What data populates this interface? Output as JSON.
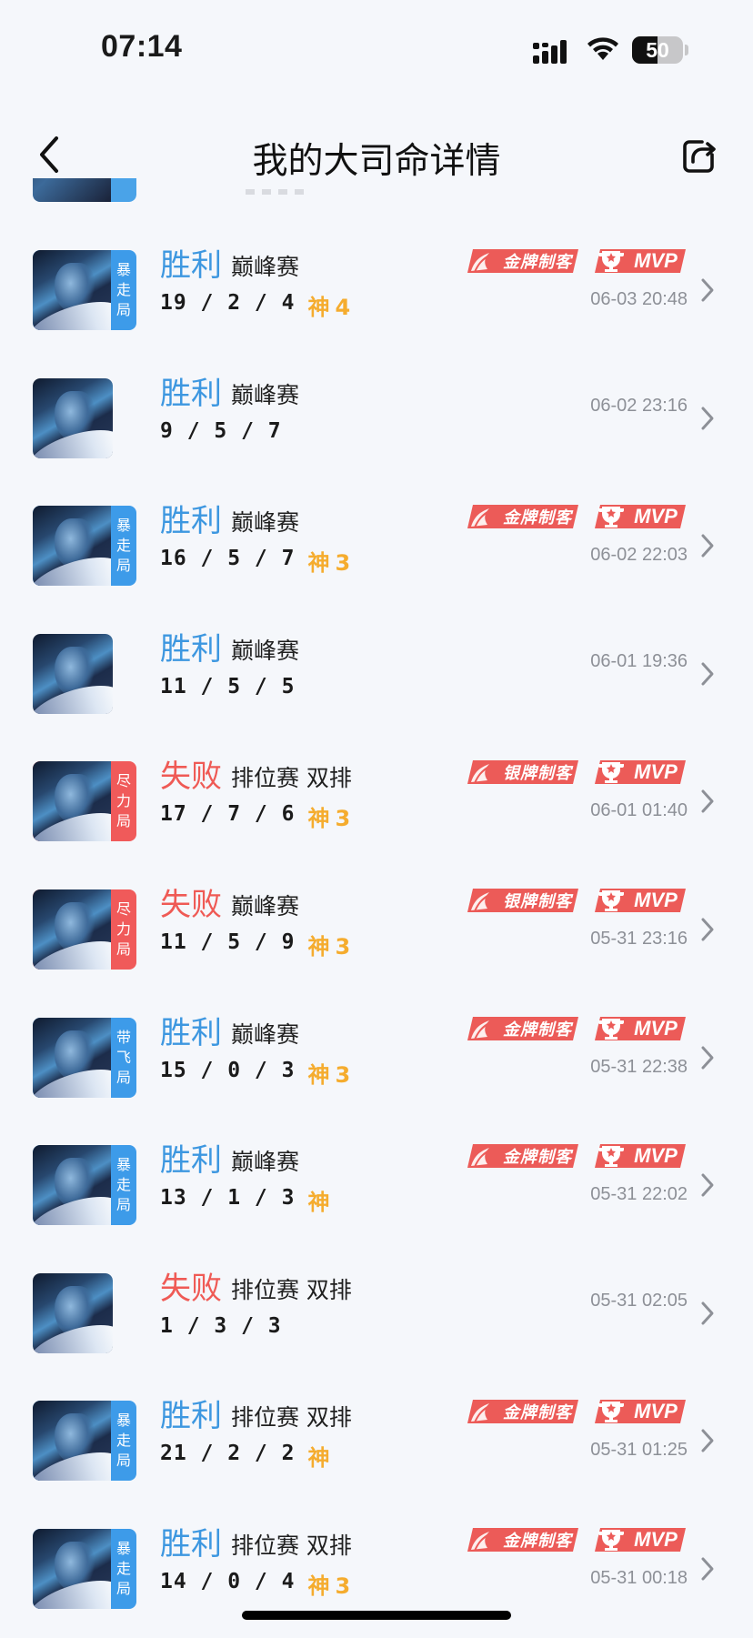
{
  "status_bar": {
    "time": "07:14",
    "battery": "50",
    "battery_level": 0.5
  },
  "header": {
    "title": "我的大司命详情"
  },
  "colors": {
    "win": "#3d97e0",
    "lose": "#ef5a55",
    "god": "#f5ac2e",
    "timestamp": "#8d9097",
    "badge": "#ec5b58"
  },
  "matches": [
    {
      "result": "胜利",
      "outcome": "win",
      "mode": "巅峰赛",
      "kda": "19 / 2 / 4",
      "god": "神",
      "god_count": "4",
      "tag": [
        "暴",
        "走",
        "局"
      ],
      "tag_color": "blue",
      "badges": {
        "killer": "金牌制客",
        "mvp": "MVP"
      },
      "time": "06-03 20:48"
    },
    {
      "result": "胜利",
      "outcome": "win",
      "mode": "巅峰赛",
      "kda": "9 / 5 / 7",
      "god": "",
      "god_count": "",
      "tag": [],
      "tag_color": "",
      "badges": null,
      "time": "06-02 23:16"
    },
    {
      "result": "胜利",
      "outcome": "win",
      "mode": "巅峰赛",
      "kda": "16 / 5 / 7",
      "god": "神",
      "god_count": "3",
      "tag": [
        "暴",
        "走",
        "局"
      ],
      "tag_color": "blue",
      "badges": {
        "killer": "金牌制客",
        "mvp": "MVP"
      },
      "time": "06-02 22:03"
    },
    {
      "result": "胜利",
      "outcome": "win",
      "mode": "巅峰赛",
      "kda": "11 / 5 / 5",
      "god": "",
      "god_count": "",
      "tag": [],
      "tag_color": "",
      "badges": null,
      "time": "06-01 19:36"
    },
    {
      "result": "失败",
      "outcome": "lose",
      "mode": "排位赛 双排",
      "kda": "17 / 7 / 6",
      "god": "神",
      "god_count": "3",
      "tag": [
        "尽",
        "力",
        "局"
      ],
      "tag_color": "red",
      "badges": {
        "killer": "银牌制客",
        "mvp": "MVP"
      },
      "time": "06-01 01:40"
    },
    {
      "result": "失败",
      "outcome": "lose",
      "mode": "巅峰赛",
      "kda": "11 / 5 / 9",
      "god": "神",
      "god_count": "3",
      "tag": [
        "尽",
        "力",
        "局"
      ],
      "tag_color": "red",
      "badges": {
        "killer": "银牌制客",
        "mvp": "MVP"
      },
      "time": "05-31 23:16"
    },
    {
      "result": "胜利",
      "outcome": "win",
      "mode": "巅峰赛",
      "kda": "15 / 0 / 3",
      "god": "神",
      "god_count": "3",
      "tag": [
        "带",
        "飞",
        "局"
      ],
      "tag_color": "blue",
      "badges": {
        "killer": "金牌制客",
        "mvp": "MVP"
      },
      "time": "05-31 22:38"
    },
    {
      "result": "胜利",
      "outcome": "win",
      "mode": "巅峰赛",
      "kda": "13 / 1 / 3",
      "god": "神",
      "god_count": "",
      "tag": [
        "暴",
        "走",
        "局"
      ],
      "tag_color": "blue",
      "badges": {
        "killer": "金牌制客",
        "mvp": "MVP"
      },
      "time": "05-31 22:02"
    },
    {
      "result": "失败",
      "outcome": "lose",
      "mode": "排位赛 双排",
      "kda": "1 / 3 / 3",
      "god": "",
      "god_count": "",
      "tag": [],
      "tag_color": "",
      "badges": null,
      "time": "05-31 02:05"
    },
    {
      "result": "胜利",
      "outcome": "win",
      "mode": "排位赛 双排",
      "kda": "21 / 2 / 2",
      "god": "神",
      "god_count": "",
      "tag": [
        "暴",
        "走",
        "局"
      ],
      "tag_color": "blue",
      "badges": {
        "killer": "金牌制客",
        "mvp": "MVP"
      },
      "time": "05-31 01:25"
    },
    {
      "result": "胜利",
      "outcome": "win",
      "mode": "排位赛 双排",
      "kda": "14 / 0 / 4",
      "god": "神",
      "god_count": "3",
      "tag": [
        "暴",
        "走",
        "局"
      ],
      "tag_color": "blue",
      "badges": {
        "killer": "金牌制客",
        "mvp": "MVP"
      },
      "time": "05-31 00:18"
    }
  ]
}
